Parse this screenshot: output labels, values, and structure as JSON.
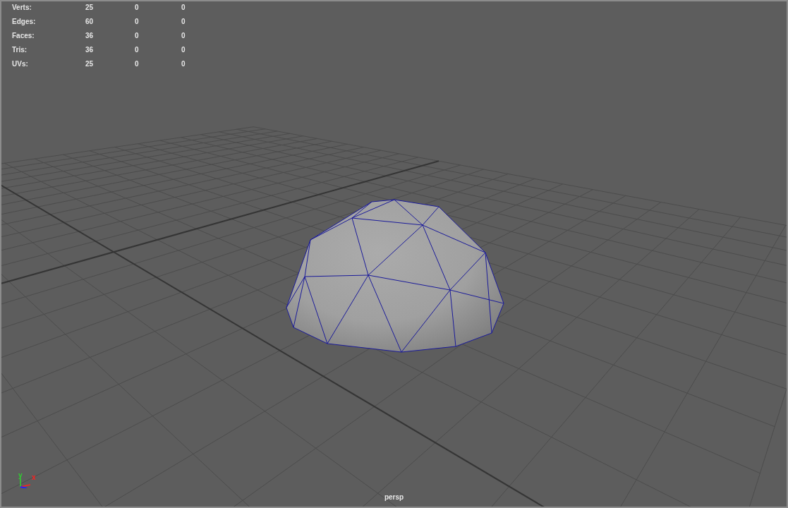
{
  "stats": [
    {
      "label": "Verts:",
      "values": [
        "25",
        "0",
        "0"
      ]
    },
    {
      "label": "Edges:",
      "values": [
        "60",
        "0",
        "0"
      ]
    },
    {
      "label": "Faces:",
      "values": [
        "36",
        "0",
        "0"
      ]
    },
    {
      "label": "Tris:",
      "values": [
        "36",
        "0",
        "0"
      ]
    },
    {
      "label": "UVs:",
      "values": [
        "25",
        "0",
        "0"
      ]
    }
  ],
  "axes": [
    {
      "kind": "y",
      "label": "y"
    },
    {
      "kind": "x",
      "label": "x"
    }
  ],
  "camera_label": "persp"
}
